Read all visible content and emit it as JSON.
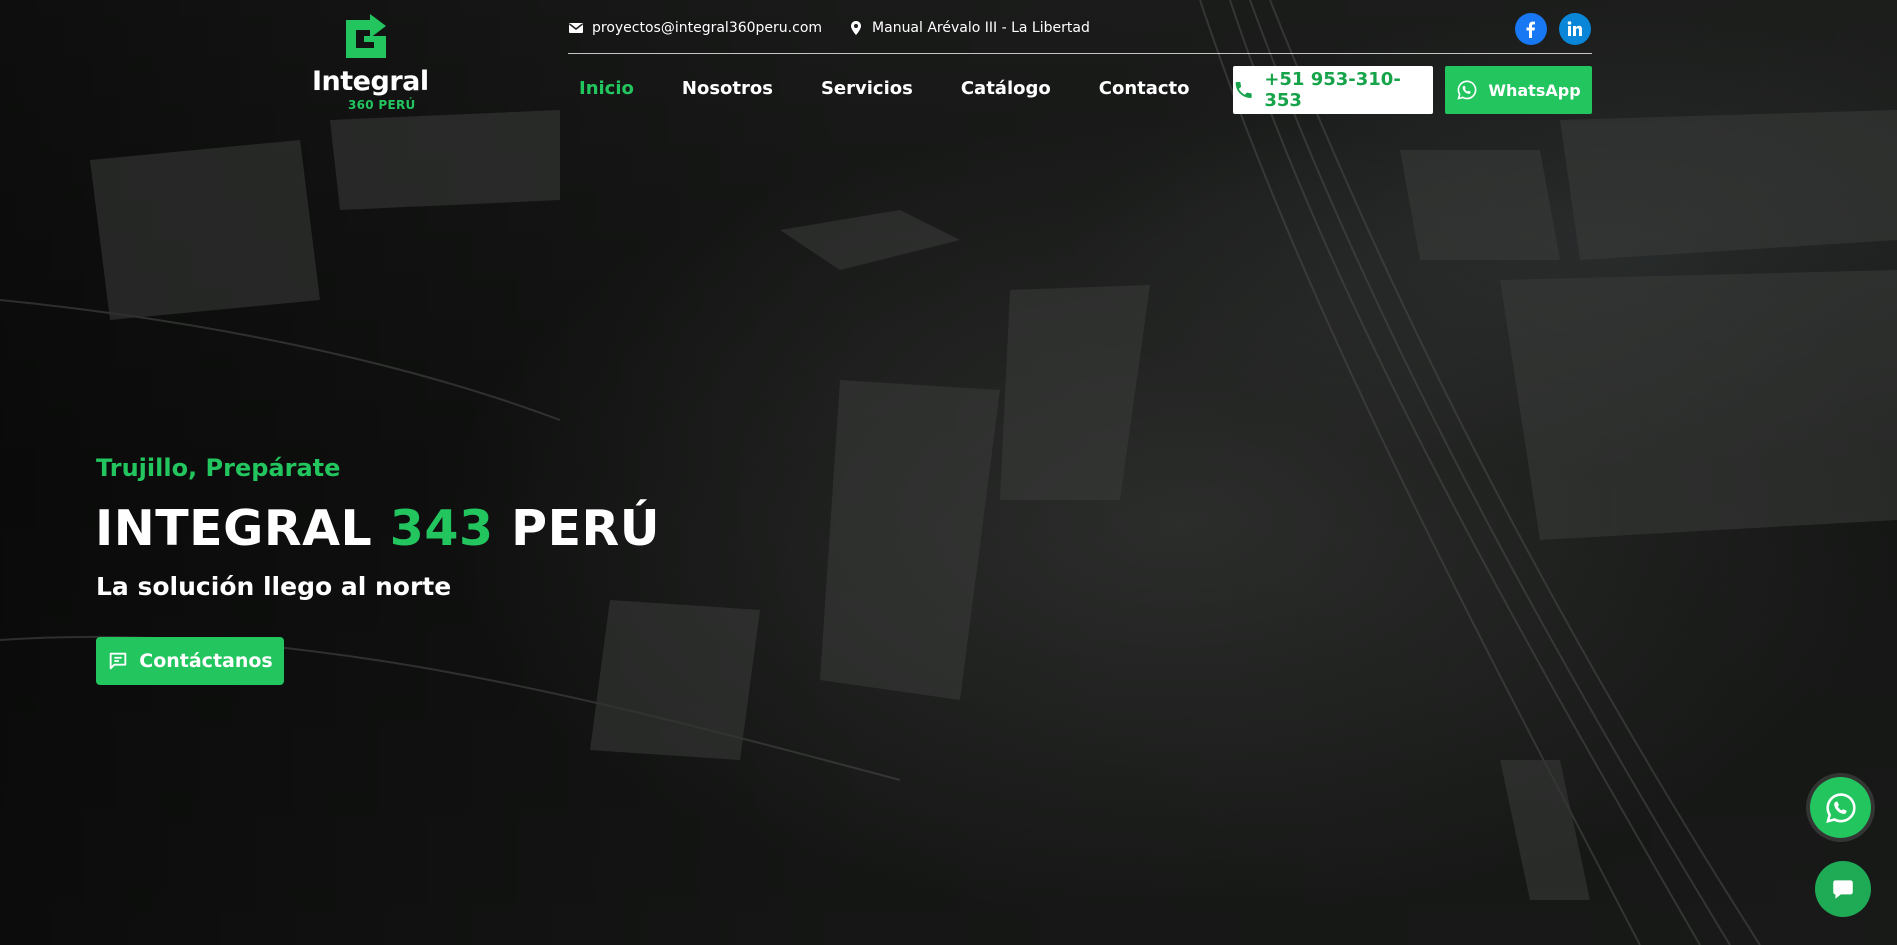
{
  "header": {
    "logo_word": "Integral",
    "logo_sub": "360 PERÚ",
    "email": "proyectos@integral360peru.com",
    "address": "Manual Arévalo III - La Libertad",
    "nav": [
      {
        "label": "Inicio",
        "active": true
      },
      {
        "label": "Nosotros"
      },
      {
        "label": "Servicios"
      },
      {
        "label": "Catálogo"
      },
      {
        "label": "Contacto"
      }
    ],
    "phone_label": "+51 953-310-353",
    "whatsapp_label": "WhatsApp",
    "icons": {
      "email": "mail-icon",
      "location": "location-pin-icon",
      "facebook": "facebook-icon",
      "linkedin": "linkedin-icon",
      "phone": "phone-icon",
      "whatsapp": "whatsapp-icon"
    }
  },
  "hero": {
    "eyebrow": "Trujillo, Prepárate",
    "title_part1": "INTEGRAL ",
    "title_accent": "343",
    "title_part2": " PERÚ",
    "subtitle": "La solución llego al norte",
    "cta_label": "Contáctanos",
    "cta_icon": "message-square-icon"
  },
  "floating": {
    "whatsapp_icon": "whatsapp-icon",
    "chat_icon": "chat-bubble-icon"
  },
  "colors": {
    "accent": "#22c55e",
    "facebook": "#1877f2",
    "linkedin": "#0a86d8"
  }
}
